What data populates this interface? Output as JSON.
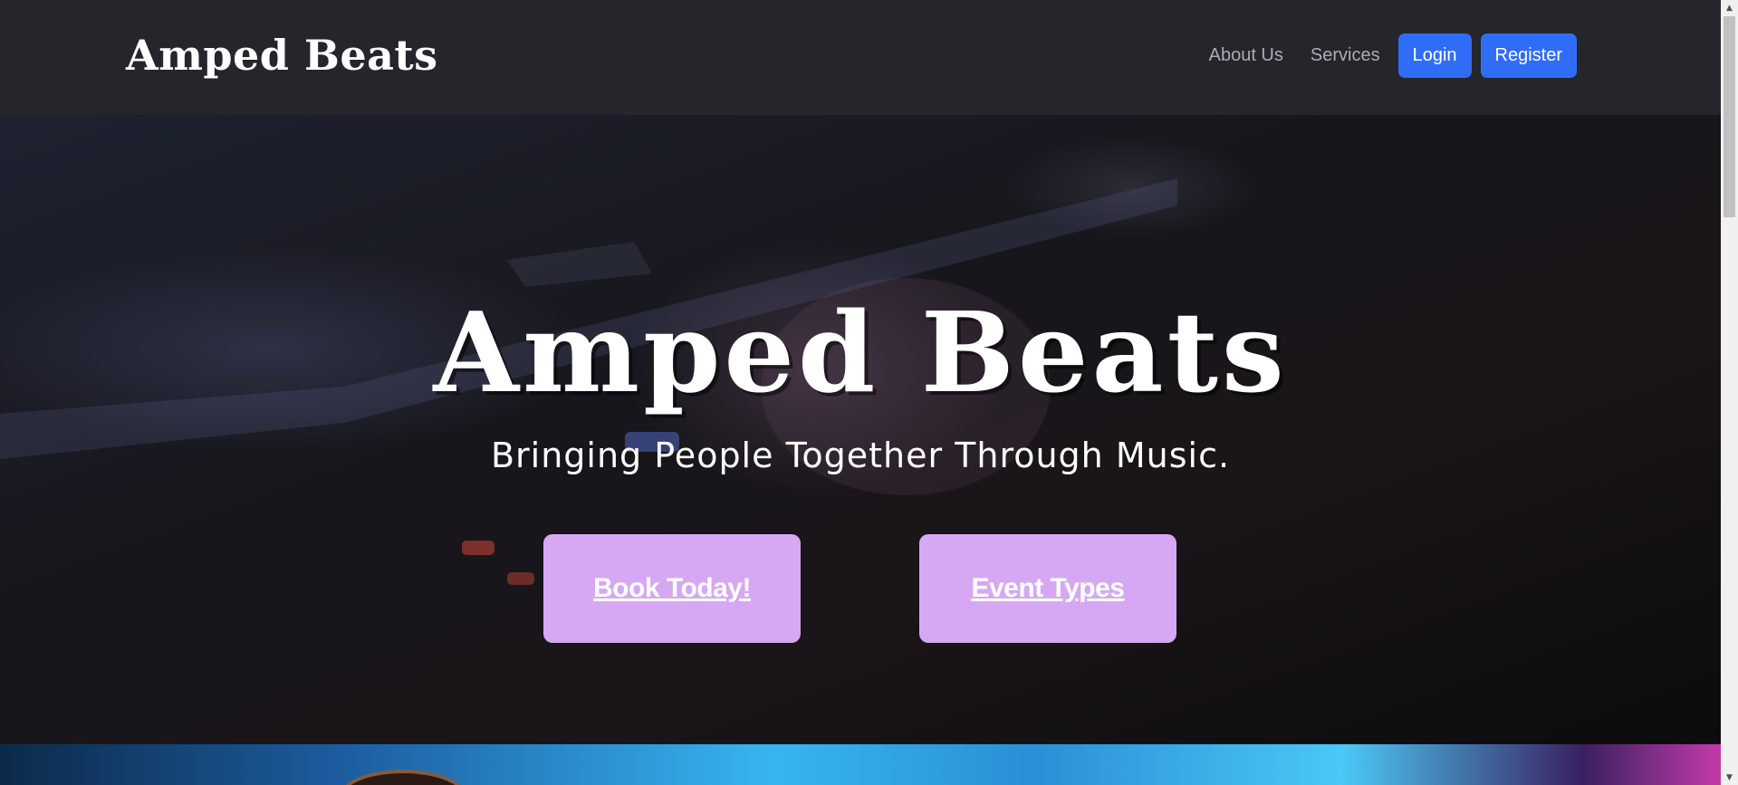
{
  "navbar": {
    "brand": "Amped Beats",
    "links": [
      {
        "label": "About Us"
      },
      {
        "label": "Services"
      }
    ],
    "login_label": "Login",
    "register_label": "Register"
  },
  "hero": {
    "title": "Amped Beats",
    "subtitle": "Bringing People Together Through Music.",
    "book_label": "Book Today!",
    "events_label": "Event Types"
  },
  "colors": {
    "navbar_bg": "#24262c",
    "primary_button": "#2f6df6",
    "cta_bg": "#d6a8f3"
  },
  "scrollbar": {
    "up_icon": "scroll-up-arrow-icon",
    "down_icon": "scroll-down-arrow-icon"
  }
}
